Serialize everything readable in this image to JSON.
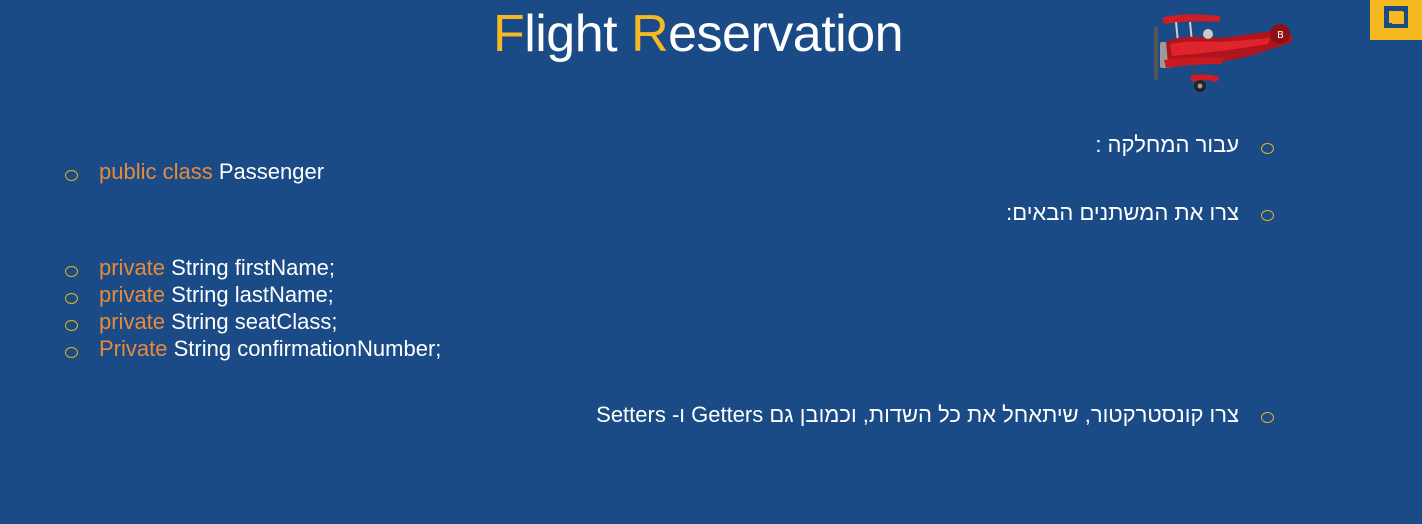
{
  "title": {
    "first_letter_1": "F",
    "rest_1": "light",
    "first_letter_2": "R",
    "rest_2": "eservation"
  },
  "colors": {
    "background": "#1a4b87",
    "accent": "#f5b921",
    "keyword": "#e88a3c",
    "text": "#ffffff"
  },
  "icons": {
    "illustration": "red-biplane-icon",
    "corner": "corner-square-decoration"
  },
  "hebrew_bullets": [
    "עבור המחלקה :",
    "צרו את המשתנים הבאים:",
    "צרו קונסטרקטור, שיתאחל את כל השדות, וכמובן גם Getters ו- Setters"
  ],
  "class_decl": {
    "keyword": "public class",
    "name": "Passenger"
  },
  "fields": [
    {
      "modifier": "private",
      "declaration": "String firstName;"
    },
    {
      "modifier": "private",
      "declaration": "String lastName;"
    },
    {
      "modifier": "private",
      "declaration": "String seatClass;"
    },
    {
      "modifier": "Private",
      "declaration": "String confirmationNumber;"
    }
  ]
}
